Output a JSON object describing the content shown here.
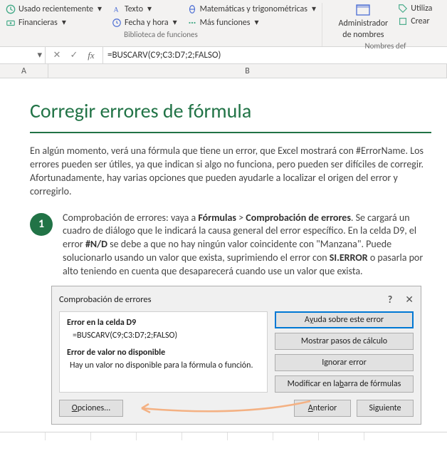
{
  "ribbon": {
    "recent": "Usado recientemente",
    "financial": "Financieras",
    "text": "Texto",
    "datetime": "Fecha y hora",
    "math": "Matemáticas y trigonométricas",
    "more": "Más funciones",
    "group_library": "Biblioteca de funciones",
    "name_mgr1": "Administrador",
    "name_mgr2": "de nombres",
    "utilize": "Utiliza",
    "create": "Crear",
    "group_names": "Nombres def"
  },
  "formula_bar": {
    "name_caret": "▾",
    "cancel": "✕",
    "confirm": "✓",
    "fx": "fx",
    "formula": "=BUSCARV(C9;C3:D7;2;FALSO)"
  },
  "columns": {
    "A": "A",
    "B": "B"
  },
  "content": {
    "title": "Corregir errores de fórmula",
    "intro": "En algún momento, verá una fórmula que tiene un error, que Excel mostrará con #ErrorName. Los errores pueden ser útiles, ya que indican si algo no funciona, pero pueden ser difíciles de corregir. Afortunadamente, hay varias opciones que pueden ayudarle a localizar el origen del error y corregirlo.",
    "step_num": "1",
    "step_pre": "Comprobación de errores: vaya a ",
    "step_b1": "Fórmulas",
    "step_gt": " > ",
    "step_b2": "Comprobación de errores",
    "step_post1": ". Se cargará un cuadro de diálogo que le indicará la causa general del error específico. En la celda D9, el error ",
    "step_b3": "#N/D",
    "step_post2": " se debe a que no hay ningún valor coincidente con \"Manzana\". Puede solucionarlo usando un valor que exista, suprimiendo el error con ",
    "step_b4": "SI.ERROR",
    "step_post3": " o pasarla por alto teniendo en cuenta que desaparecerá cuando use un valor que exista."
  },
  "dialog": {
    "title": "Comprobación de errores",
    "help": "?",
    "close": "✕",
    "err_head": "Error en la celda D9",
    "err_formula": "=BUSCARV(C9;C3:D7;2;FALSO)",
    "err_type": "Error de valor no disponible",
    "err_msg": "Hay un valor no disponible para la fórmula o función.",
    "btn_help_pre": "A",
    "btn_help_acc": "y",
    "btn_help_post": "uda sobre este error",
    "btn_steps": "Mostrar pasos de cálculo",
    "btn_ignore": "Ignorar error",
    "btn_edit_pre": "Modificar en la ",
    "btn_edit_acc": "b",
    "btn_edit_post": "arra de fórmulas",
    "btn_options_acc": "O",
    "btn_options_post": "pciones...",
    "btn_prev_acc": "A",
    "btn_prev_post": "nterior",
    "btn_next_pre": "Si",
    "btn_next_acc": "g",
    "btn_next_post": "uiente"
  }
}
